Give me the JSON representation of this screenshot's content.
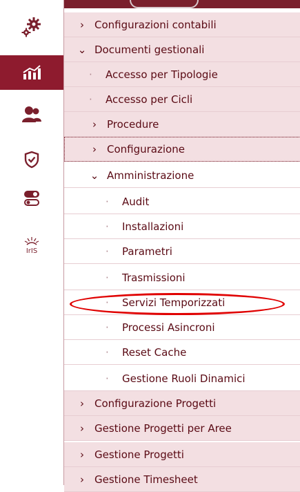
{
  "rail": {
    "items": [
      {
        "icon": "gears-icon"
      },
      {
        "icon": "chart-icon"
      },
      {
        "icon": "users-icon"
      },
      {
        "icon": "shield-check-icon"
      },
      {
        "icon": "toggle-icon"
      },
      {
        "icon": "iris-logo",
        "text": "Iris"
      }
    ]
  },
  "menu": {
    "configurazioni_contabili": "Configurazioni contabili",
    "documenti_gestionali": "Documenti gestionali",
    "accesso_tipologie": "Accesso per Tipologie",
    "accesso_cicli": "Accesso per Cicli",
    "procedure": "Procedure",
    "configurazione": "Configurazione",
    "amministrazione": "Amministrazione",
    "audit": "Audit",
    "installazioni": "Installazioni",
    "parametri": "Parametri",
    "trasmissioni": "Trasmissioni",
    "servizi_temporizzati": "Servizi Temporizzati",
    "processi_asincroni": "Processi Asincroni",
    "reset_cache": "Reset Cache",
    "gestione_ruoli_dinamici": "Gestione Ruoli Dinamici",
    "configurazione_progetti": "Configurazione Progetti",
    "gestione_progetti_aree": "Gestione Progetti per Aree",
    "gestione_progetti": "Gestione Progetti",
    "gestione_timesheet": "Gestione Timesheet"
  },
  "glyphs": {
    "collapsed": "›",
    "expanded": "⌄",
    "bullet": "·"
  },
  "colors": {
    "brand": "#8e1b2e",
    "highlight": "#e00000",
    "section_bg": "#f3dfe2"
  }
}
